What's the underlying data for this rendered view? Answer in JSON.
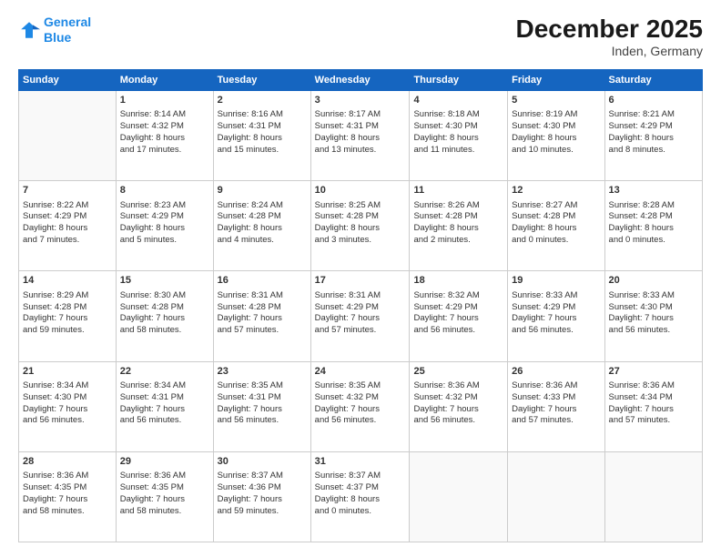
{
  "logo": {
    "line1": "General",
    "line2": "Blue"
  },
  "title": "December 2025",
  "location": "Inden, Germany",
  "days_of_week": [
    "Sunday",
    "Monday",
    "Tuesday",
    "Wednesday",
    "Thursday",
    "Friday",
    "Saturday"
  ],
  "weeks": [
    [
      {
        "day": "",
        "info": ""
      },
      {
        "day": "1",
        "info": "Sunrise: 8:14 AM\nSunset: 4:32 PM\nDaylight: 8 hours\nand 17 minutes."
      },
      {
        "day": "2",
        "info": "Sunrise: 8:16 AM\nSunset: 4:31 PM\nDaylight: 8 hours\nand 15 minutes."
      },
      {
        "day": "3",
        "info": "Sunrise: 8:17 AM\nSunset: 4:31 PM\nDaylight: 8 hours\nand 13 minutes."
      },
      {
        "day": "4",
        "info": "Sunrise: 8:18 AM\nSunset: 4:30 PM\nDaylight: 8 hours\nand 11 minutes."
      },
      {
        "day": "5",
        "info": "Sunrise: 8:19 AM\nSunset: 4:30 PM\nDaylight: 8 hours\nand 10 minutes."
      },
      {
        "day": "6",
        "info": "Sunrise: 8:21 AM\nSunset: 4:29 PM\nDaylight: 8 hours\nand 8 minutes."
      }
    ],
    [
      {
        "day": "7",
        "info": "Sunrise: 8:22 AM\nSunset: 4:29 PM\nDaylight: 8 hours\nand 7 minutes."
      },
      {
        "day": "8",
        "info": "Sunrise: 8:23 AM\nSunset: 4:29 PM\nDaylight: 8 hours\nand 5 minutes."
      },
      {
        "day": "9",
        "info": "Sunrise: 8:24 AM\nSunset: 4:28 PM\nDaylight: 8 hours\nand 4 minutes."
      },
      {
        "day": "10",
        "info": "Sunrise: 8:25 AM\nSunset: 4:28 PM\nDaylight: 8 hours\nand 3 minutes."
      },
      {
        "day": "11",
        "info": "Sunrise: 8:26 AM\nSunset: 4:28 PM\nDaylight: 8 hours\nand 2 minutes."
      },
      {
        "day": "12",
        "info": "Sunrise: 8:27 AM\nSunset: 4:28 PM\nDaylight: 8 hours\nand 0 minutes."
      },
      {
        "day": "13",
        "info": "Sunrise: 8:28 AM\nSunset: 4:28 PM\nDaylight: 8 hours\nand 0 minutes."
      }
    ],
    [
      {
        "day": "14",
        "info": "Sunrise: 8:29 AM\nSunset: 4:28 PM\nDaylight: 7 hours\nand 59 minutes."
      },
      {
        "day": "15",
        "info": "Sunrise: 8:30 AM\nSunset: 4:28 PM\nDaylight: 7 hours\nand 58 minutes."
      },
      {
        "day": "16",
        "info": "Sunrise: 8:31 AM\nSunset: 4:28 PM\nDaylight: 7 hours\nand 57 minutes."
      },
      {
        "day": "17",
        "info": "Sunrise: 8:31 AM\nSunset: 4:29 PM\nDaylight: 7 hours\nand 57 minutes."
      },
      {
        "day": "18",
        "info": "Sunrise: 8:32 AM\nSunset: 4:29 PM\nDaylight: 7 hours\nand 56 minutes."
      },
      {
        "day": "19",
        "info": "Sunrise: 8:33 AM\nSunset: 4:29 PM\nDaylight: 7 hours\nand 56 minutes."
      },
      {
        "day": "20",
        "info": "Sunrise: 8:33 AM\nSunset: 4:30 PM\nDaylight: 7 hours\nand 56 minutes."
      }
    ],
    [
      {
        "day": "21",
        "info": "Sunrise: 8:34 AM\nSunset: 4:30 PM\nDaylight: 7 hours\nand 56 minutes."
      },
      {
        "day": "22",
        "info": "Sunrise: 8:34 AM\nSunset: 4:31 PM\nDaylight: 7 hours\nand 56 minutes."
      },
      {
        "day": "23",
        "info": "Sunrise: 8:35 AM\nSunset: 4:31 PM\nDaylight: 7 hours\nand 56 minutes."
      },
      {
        "day": "24",
        "info": "Sunrise: 8:35 AM\nSunset: 4:32 PM\nDaylight: 7 hours\nand 56 minutes."
      },
      {
        "day": "25",
        "info": "Sunrise: 8:36 AM\nSunset: 4:32 PM\nDaylight: 7 hours\nand 56 minutes."
      },
      {
        "day": "26",
        "info": "Sunrise: 8:36 AM\nSunset: 4:33 PM\nDaylight: 7 hours\nand 57 minutes."
      },
      {
        "day": "27",
        "info": "Sunrise: 8:36 AM\nSunset: 4:34 PM\nDaylight: 7 hours\nand 57 minutes."
      }
    ],
    [
      {
        "day": "28",
        "info": "Sunrise: 8:36 AM\nSunset: 4:35 PM\nDaylight: 7 hours\nand 58 minutes."
      },
      {
        "day": "29",
        "info": "Sunrise: 8:36 AM\nSunset: 4:35 PM\nDaylight: 7 hours\nand 58 minutes."
      },
      {
        "day": "30",
        "info": "Sunrise: 8:37 AM\nSunset: 4:36 PM\nDaylight: 7 hours\nand 59 minutes."
      },
      {
        "day": "31",
        "info": "Sunrise: 8:37 AM\nSunset: 4:37 PM\nDaylight: 8 hours\nand 0 minutes."
      },
      {
        "day": "",
        "info": ""
      },
      {
        "day": "",
        "info": ""
      },
      {
        "day": "",
        "info": ""
      }
    ]
  ]
}
